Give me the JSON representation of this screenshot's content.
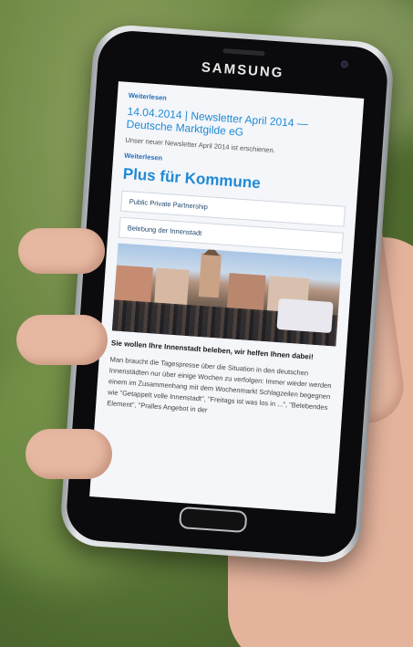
{
  "device": {
    "brand": "SAMSUNG"
  },
  "page": {
    "link1": "Weiterlesen",
    "newsletter_title": "14.04.2014 | Newsletter April 2014 — Deutsche Marktgilde eG",
    "newsletter_desc": "Unser neuer Newsletter April 2014 ist erschienen.",
    "link2": "Weiterlesen",
    "section_title": "Plus für Kommune",
    "accordion": [
      "Public Private Partnership",
      "Belebung der Innenstadt"
    ],
    "lead": "Sie wollen Ihre Innenstadt beleben, wir helfen Ihnen dabei!",
    "body": "Man braucht die Tagespresse über die Situation in den deutschen Innenstädten nur über einige Wochen zu verfolgen: Immer wieder werden einem im Zusammenhang mit dem Wochenmarkt Schlagzeilen begegnen wie \"Getappelt volle Innenstadt\", \"Freitags ist was los in ...\", \"Belebendes Element\", \"Pralles Angebot in der"
  },
  "colors": {
    "accent": "#1f8ad3",
    "background": "#f4f6fa"
  }
}
